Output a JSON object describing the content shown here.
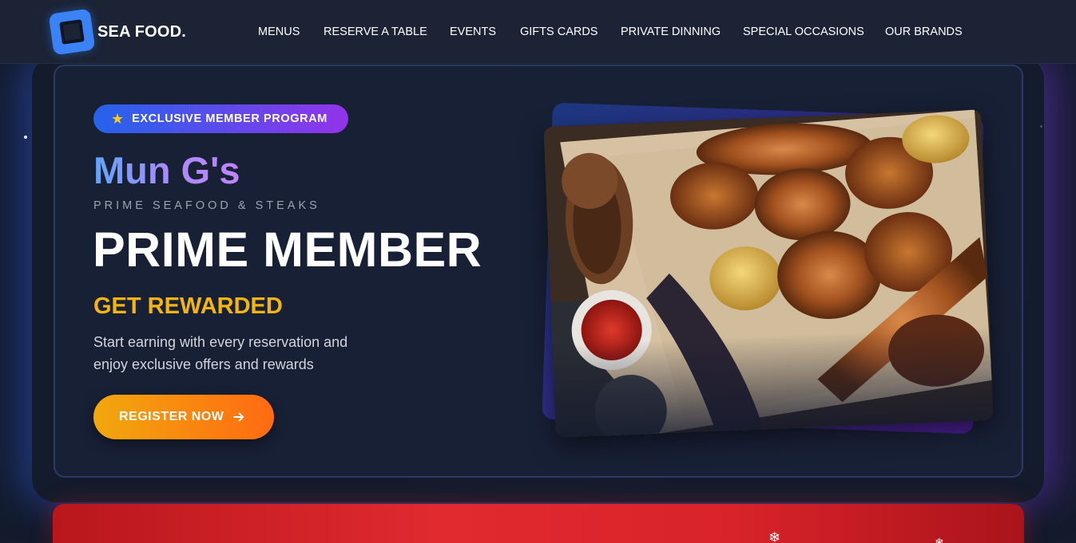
{
  "brand": {
    "name": "SEA FOOD.",
    "logo_icon": "square-logo-icon"
  },
  "nav": {
    "items": [
      {
        "label": "MENUS"
      },
      {
        "label": "RESERVE A TABLE"
      },
      {
        "label": "EVENTS"
      },
      {
        "label": "GIFTS CARDS"
      },
      {
        "label": "PRIVATE DINNING"
      },
      {
        "label": "SPECIAL OCCASIONS"
      },
      {
        "label": "OUR BRANDS"
      }
    ]
  },
  "hero": {
    "badge": {
      "icon": "star-icon",
      "label": "EXCLUSIVE MEMBER PROGRAM"
    },
    "restaurant_name": "Mun G's",
    "subtitle": "PRIME SEAFOOD & STEAKS",
    "headline": "PRIME MEMBER",
    "tagline": "GET REWARDED",
    "description_line1": "Start earning with every reservation and",
    "description_line2": "enjoy exclusive offers and rewards",
    "cta": {
      "label": "REGISTER NOW",
      "icon": "arrow-right-icon"
    },
    "image": {
      "subject": "grilled-meat-platter-image"
    }
  },
  "promo_banner": {
    "icon": "snowflake-icon"
  },
  "colors": {
    "background": "#131b2c",
    "navbar": "#1b2335",
    "card": "#182036",
    "accent_blue": "#2563eb",
    "accent_purple": "#9333ea",
    "accent_gold": "#f5b50f",
    "cta_orange": "#ff6a12",
    "promo_red": "#e02a30"
  }
}
